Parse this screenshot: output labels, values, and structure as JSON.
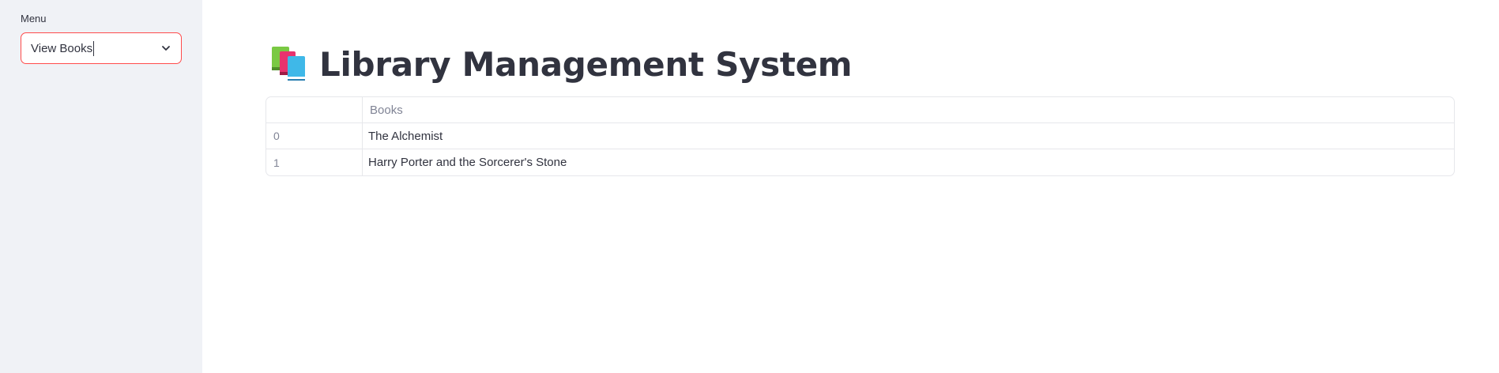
{
  "sidebar": {
    "menu_label": "Menu",
    "select": {
      "value": "View Books"
    }
  },
  "main": {
    "title_icon": "books-icon",
    "title": "Library Management System",
    "table": {
      "columns": [
        "",
        "Books"
      ],
      "rows": [
        {
          "index": "0",
          "book": "The Alchemist"
        },
        {
          "index": "1",
          "book": "Harry Porter and the Sorcerer's Stone"
        }
      ]
    }
  },
  "colors": {
    "sidebar_bg": "#f0f2f6",
    "accent_border": "#ff4b4b",
    "text": "#31333f",
    "muted_text": "#808495"
  }
}
